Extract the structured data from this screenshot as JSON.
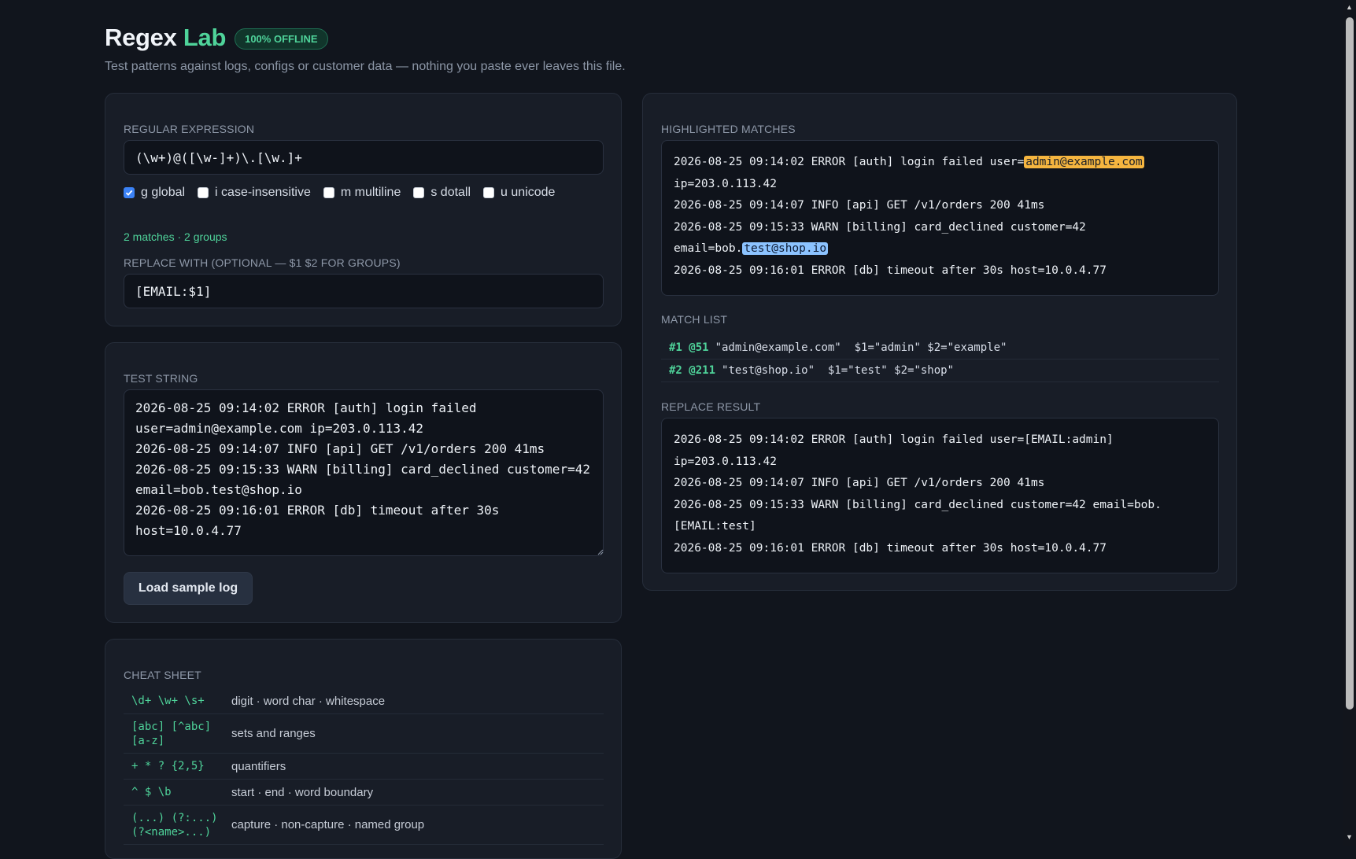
{
  "header": {
    "title_main": "Regex",
    "title_accent": "Lab",
    "badge": "100% OFFLINE",
    "subtitle": "Test patterns against logs, configs or customer data — nothing you paste ever leaves this file."
  },
  "regex_panel": {
    "label": "REGULAR EXPRESSION",
    "pattern": "(\\w+)@([\\w-]+)\\.[\\w.]+",
    "flags": [
      {
        "label": "g global",
        "checked": true
      },
      {
        "label": "i case-insensitive",
        "checked": false
      },
      {
        "label": "m multiline",
        "checked": false
      },
      {
        "label": "s dotall",
        "checked": false
      },
      {
        "label": "u unicode",
        "checked": false
      }
    ],
    "stats": "2 matches · 2 groups",
    "replace_label": "REPLACE WITH (OPTIONAL — $1 $2 FOR GROUPS)",
    "replace_value": "[EMAIL:$1]"
  },
  "test_panel": {
    "label": "TEST STRING",
    "text": "2026-08-25 09:14:02 ERROR [auth] login failed\nuser=admin@example.com ip=203.0.113.42\n2026-08-25 09:14:07 INFO [api] GET /v1/orders 200 41ms\n2026-08-25 09:15:33 WARN [billing] card_declined customer=42\nemail=bob.test@shop.io\n2026-08-25 09:16:01 ERROR [db] timeout after 30s\nhost=10.0.4.77",
    "load_button": "Load sample log"
  },
  "cheat_sheet": {
    "label": "CHEAT SHEET",
    "rows": [
      {
        "code": "\\d+ \\w+ \\s+",
        "desc": "digit · word char · whitespace"
      },
      {
        "code": "[abc] [^abc]\n[a-z]",
        "desc": "sets and ranges"
      },
      {
        "code": "+ * ? {2,5}",
        "desc": "quantifiers"
      },
      {
        "code": "^ $ \\b",
        "desc": "start · end · word boundary"
      },
      {
        "code": "(...) (?:...)\n(?<name>...)",
        "desc": "capture · non-capture · named group"
      }
    ]
  },
  "results": {
    "highlight_label": "HIGHLIGHTED MATCHES",
    "highlight": {
      "l1": "2026-08-25 09:14:02 ERROR [auth] login failed user=",
      "m1": "admin@example.com",
      "l2": "ip=203.0.113.42",
      "l3": "2026-08-25 09:14:07 INFO [api] GET /v1/orders 200 41ms",
      "l4": "2026-08-25 09:15:33 WARN [billing] card_declined customer=42",
      "l5": "email=bob.",
      "m2": "test@shop.io",
      "l6": "2026-08-25 09:16:01 ERROR [db] timeout after 30s host=10.0.4.77"
    },
    "match_list_label": "MATCH LIST",
    "matches": [
      {
        "num": "#1 @51",
        "detail": "\"admin@example.com\"  $1=\"admin\" $2=\"example\""
      },
      {
        "num": "#2 @211",
        "detail": "\"test@shop.io\"  $1=\"test\" $2=\"shop\""
      }
    ],
    "replace_label": "REPLACE RESULT",
    "replace_result": "2026-08-25 09:14:02 ERROR [auth] login failed user=[EMAIL:admin]\nip=203.0.113.42\n2026-08-25 09:14:07 INFO [api] GET /v1/orders 200 41ms\n2026-08-25 09:15:33 WARN [billing] card_declined customer=42 email=bob.\n[EMAIL:test]\n2026-08-25 09:16:01 ERROR [db] timeout after 30s host=10.0.4.77"
  },
  "colors": {
    "accent": "#4fd39a",
    "match1": "#f5b53f",
    "match2": "#8cc3ff",
    "background": "#11151d"
  }
}
